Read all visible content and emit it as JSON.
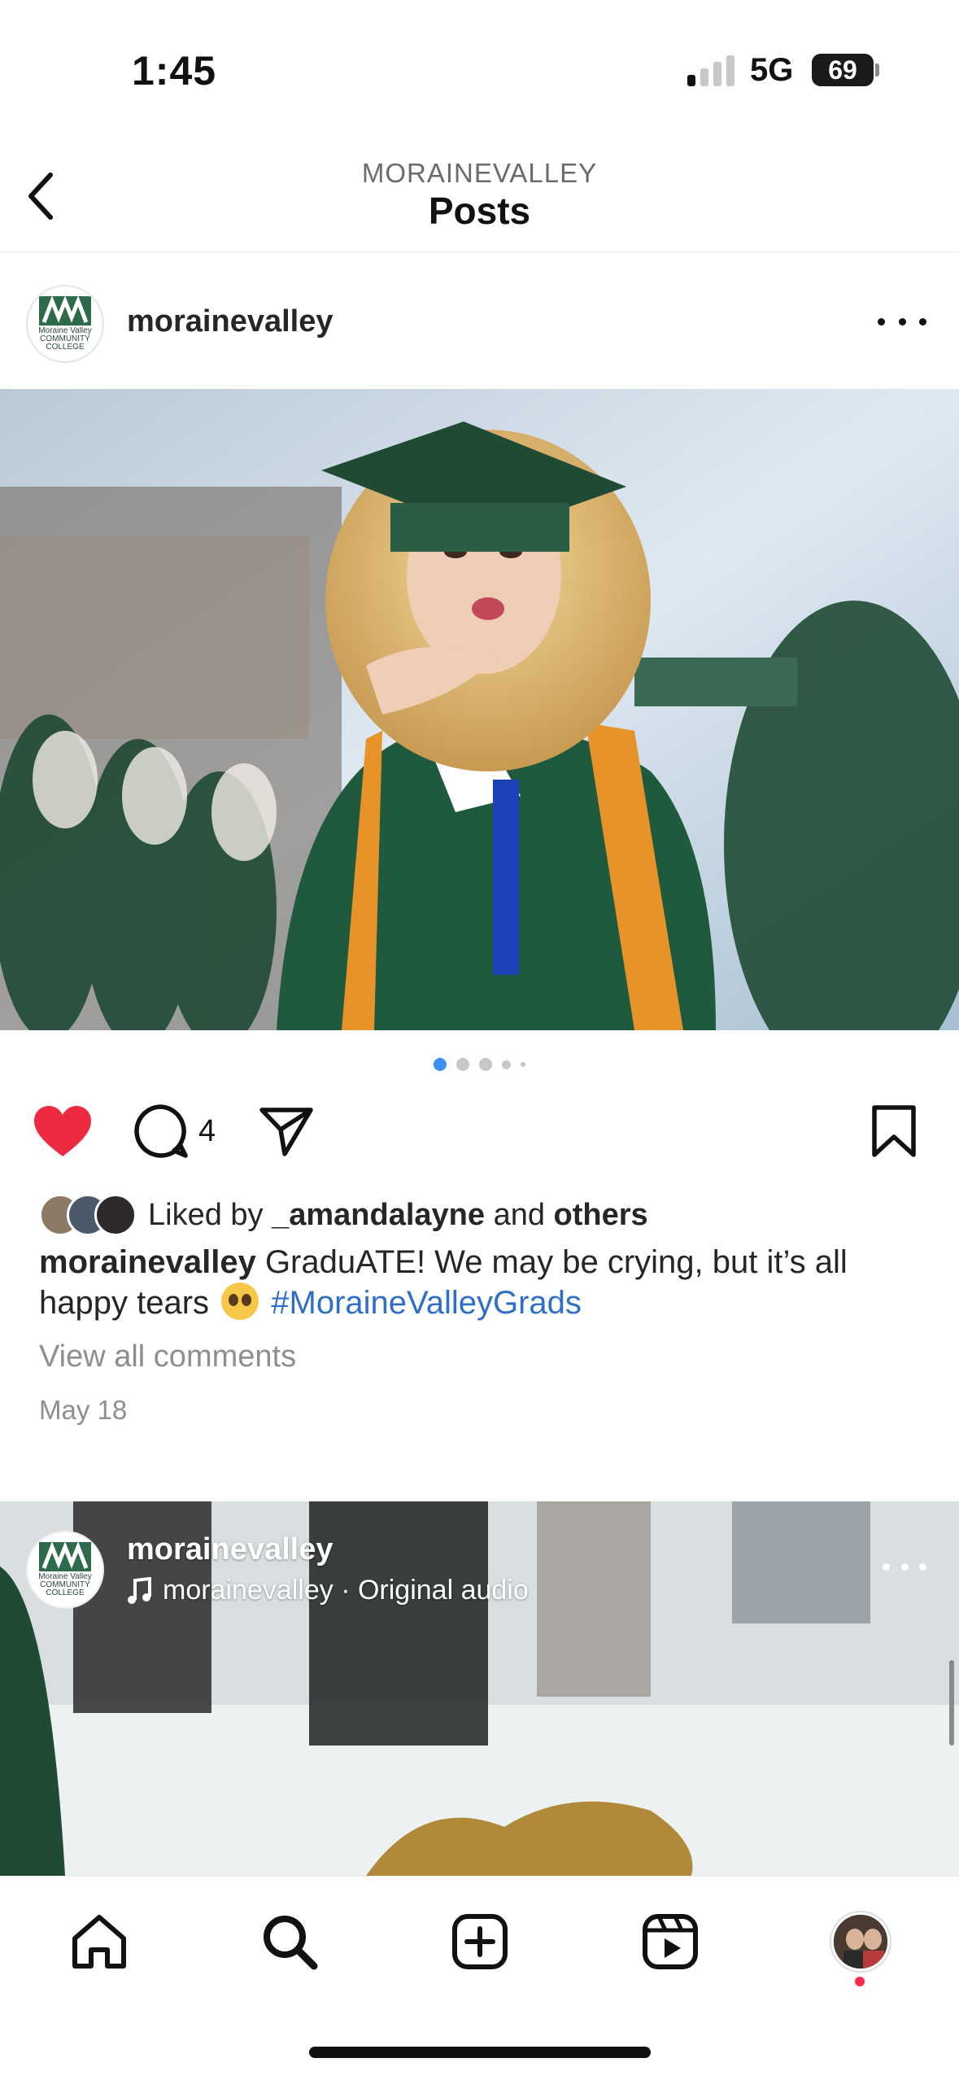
{
  "status_bar": {
    "time": "1:45",
    "network": "5G",
    "battery": "69"
  },
  "header": {
    "account": "MORAINEVALLEY",
    "title": "Posts"
  },
  "post": {
    "username": "morainevalley",
    "avatar_caption": "Moraine Valley COMMUNITY COLLEGE",
    "carousel": {
      "count": 5,
      "active_index": 0
    },
    "comment_count": "4",
    "liked": true,
    "likes": {
      "prefix": "Liked by ",
      "user": "_amandalayne",
      "middle": " and ",
      "others": "others"
    },
    "caption": {
      "user": "morainevalley",
      "text": " GraduATE! We may be crying, but it’s all happy tears ",
      "hashtag": "#MoraineValleyGrads"
    },
    "view_comments": "View all comments",
    "date": "May 18"
  },
  "reel": {
    "username": "morainevalley",
    "audio": "morainevalley · Original audio"
  },
  "colors": {
    "like_red": "#ed2a3f",
    "link_blue": "#2f6fc7",
    "brand_green": "#1c4d35"
  },
  "tabs": [
    "home",
    "search",
    "create",
    "reels",
    "profile"
  ]
}
